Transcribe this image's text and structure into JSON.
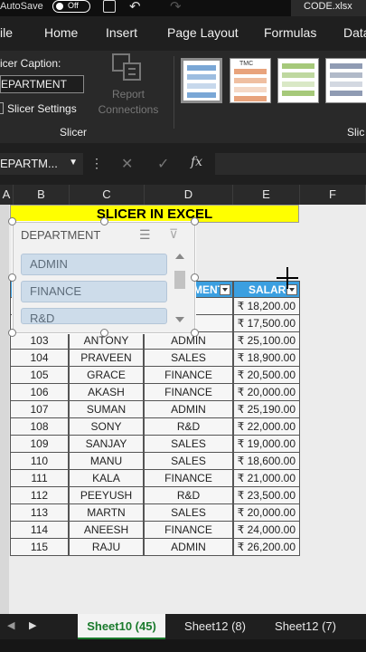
{
  "titlebar": {
    "autosave": "AutoSave",
    "toggle": "Off",
    "filename": "CODE.xlsx"
  },
  "menu": [
    "ile",
    "Home",
    "Insert",
    "Page Layout",
    "Formulas",
    "Data"
  ],
  "ribbon": {
    "caption_label": "icer Caption:",
    "caption_value": "EPARTMENT",
    "slicer_settings": "Slicer Settings",
    "report_connections": "Report Connections",
    "group_slicer": "Slicer",
    "group_right": "Slic",
    "style_badge": "TMC"
  },
  "formula_bar": {
    "name_box": "EPARTM...",
    "fx": "fx"
  },
  "columns": [
    "A",
    "B",
    "C",
    "D",
    "E",
    "F"
  ],
  "sheet": {
    "title": "SLICER IN EXCEL",
    "headers": [
      "",
      "",
      "MENT",
      "SALARY"
    ],
    "rows": [
      [
        "",
        "",
        "S",
        "₹ 18,200.00"
      ],
      [
        "",
        "",
        "S",
        "₹ 17,500.00"
      ],
      [
        "103",
        "ANTONY",
        "ADMIN",
        "₹ 25,100.00"
      ],
      [
        "104",
        "PRAVEEN",
        "SALES",
        "₹ 18,900.00"
      ],
      [
        "105",
        "GRACE",
        "FINANCE",
        "₹ 20,500.00"
      ],
      [
        "106",
        "AKASH",
        "FINANCE",
        "₹ 20,000.00"
      ],
      [
        "107",
        "SUMAN",
        "ADMIN",
        "₹ 25,190.00"
      ],
      [
        "108",
        "SONY",
        "R&D",
        "₹ 22,000.00"
      ],
      [
        "109",
        "SANJAY",
        "SALES",
        "₹ 19,000.00"
      ],
      [
        "110",
        "MANU",
        "SALES",
        "₹ 18,600.00"
      ],
      [
        "111",
        "KALA",
        "FINANCE",
        "₹ 21,000.00"
      ],
      [
        "112",
        "PEEYUSH",
        "R&D",
        "₹ 23,500.00"
      ],
      [
        "113",
        "MARTN",
        "SALES",
        "₹ 20,000.00"
      ],
      [
        "114",
        "ANEESH",
        "FINANCE",
        "₹ 24,000.00"
      ],
      [
        "115",
        "RAJU",
        "ADMIN",
        "₹ 26,200.00"
      ]
    ]
  },
  "slicer": {
    "header": "DEPARTMENT",
    "items": [
      "ADMIN",
      "FINANCE",
      "R&D"
    ]
  },
  "tabs": [
    "Sheet10 (45)",
    "Sheet12 (8)",
    "Sheet12 (7)"
  ],
  "colors": {
    "header_blue": "#3b9fe0",
    "title_yellow": "#ffff00",
    "tab_green": "#1a7a2c"
  }
}
